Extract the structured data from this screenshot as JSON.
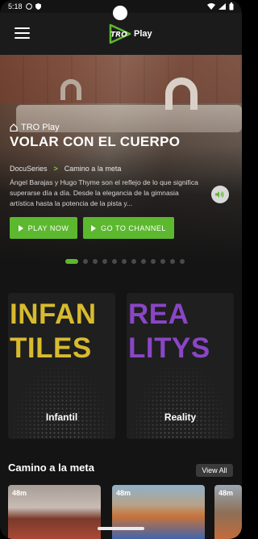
{
  "status_bar": {
    "time": "5:18"
  },
  "app": {
    "logo_text": "Play",
    "logo_mark": "TRO"
  },
  "hero": {
    "brand": "TRO Play",
    "title": "VOLAR CON EL CUERPO",
    "crumb_series": "DocuSeries",
    "crumb_sep": ">",
    "crumb_show": "Camino a la meta",
    "description": "Ángel Barajas y Hugo Thyme son el reflejo de lo que significa superarse día a día. Desde la elegancia de la gimnasia artística hasta la potencia de la pista y...",
    "play_label": "PLAY NOW",
    "channel_label": "GO TO CHANNEL",
    "slide_count": 12,
    "active_slide": 1
  },
  "categories": [
    {
      "art_line1": "INFAN",
      "art_line2": "TILES",
      "caption": "Infantil",
      "color": "#d8bb2e"
    },
    {
      "art_line1": "REA",
      "art_line2": "LITYS",
      "caption": "Reality",
      "color": "#8a46c6"
    }
  ],
  "section": {
    "title": "Camino a la meta",
    "view_all": "View All",
    "items": [
      {
        "duration": "48m"
      },
      {
        "duration": "48m"
      },
      {
        "duration": "48m"
      }
    ]
  },
  "colors": {
    "accent": "#5cb82e",
    "background": "#141414"
  }
}
